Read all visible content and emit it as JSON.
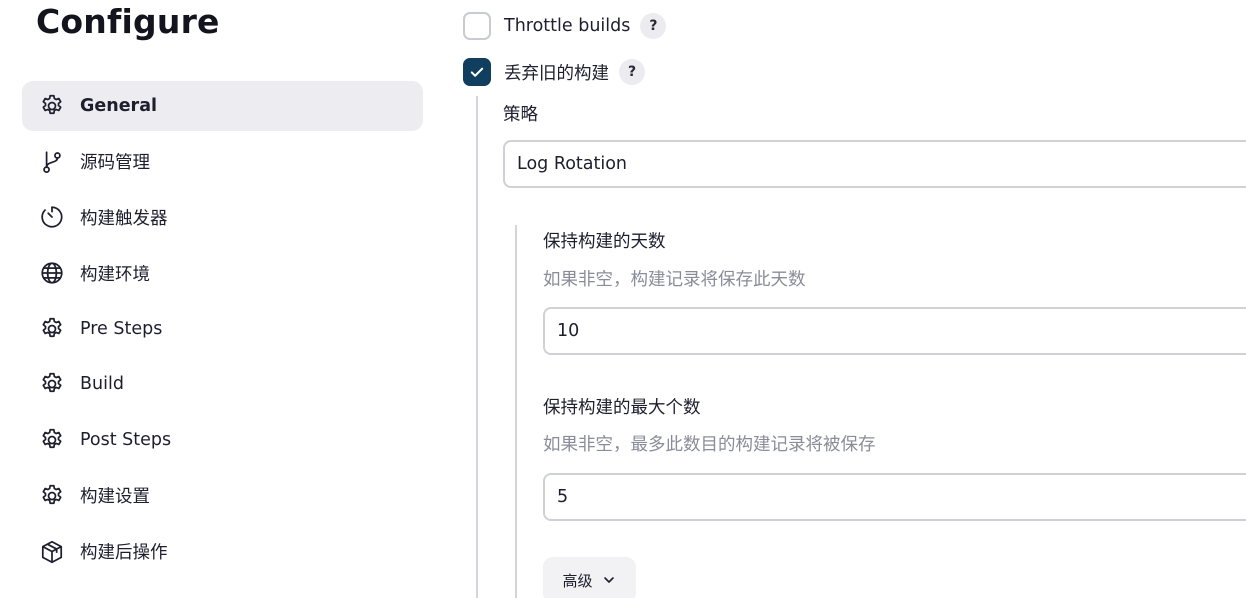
{
  "header": {
    "title": "Configure"
  },
  "sidebar": {
    "items": [
      {
        "label": "General",
        "icon": "gear-icon",
        "active": true
      },
      {
        "label": "源码管理",
        "icon": "git-branch-icon",
        "active": false
      },
      {
        "label": "构建触发器",
        "icon": "timer-icon",
        "active": false
      },
      {
        "label": "构建环境",
        "icon": "globe-icon",
        "active": false
      },
      {
        "label": "Pre Steps",
        "icon": "gear-icon",
        "active": false
      },
      {
        "label": "Build",
        "icon": "gear-icon",
        "active": false
      },
      {
        "label": "Post Steps",
        "icon": "gear-icon",
        "active": false
      },
      {
        "label": "构建设置",
        "icon": "gear-icon",
        "active": false
      },
      {
        "label": "构建后操作",
        "icon": "package-icon",
        "active": false
      }
    ]
  },
  "main": {
    "throttle": {
      "label": "Throttle builds",
      "checked": false,
      "help": "?"
    },
    "discard": {
      "label": "丢弃旧的构建",
      "checked": true,
      "help": "?"
    },
    "strategy": {
      "label": "策略",
      "value": "Log Rotation"
    },
    "days_to_keep": {
      "label": "保持构建的天数",
      "description": "如果非空，构建记录将保存此天数",
      "value": "10"
    },
    "max_builds": {
      "label": "保持构建的最大个数",
      "description": "如果非空，最多此数目的构建记录将被保存",
      "value": "5"
    },
    "advanced": {
      "label": "高级",
      "icon": "chevron-down-icon"
    }
  },
  "colors": {
    "accent": "#0f3e5e",
    "active_nav_bg": "#ececf1",
    "muted_text": "#8a8d99",
    "border": "#cfd1d7"
  }
}
